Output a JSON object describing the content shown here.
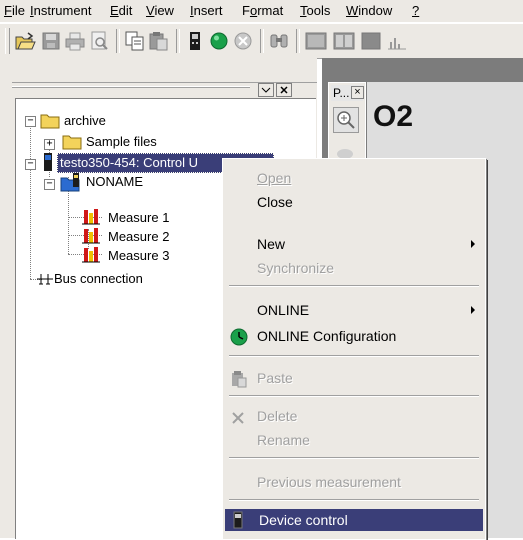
{
  "menubar": {
    "items": [
      {
        "u": "F",
        "rest": "ile"
      },
      {
        "u": "I",
        "rest": "nstrument"
      },
      {
        "u": "E",
        "rest": "dit"
      },
      {
        "u": "V",
        "rest": "iew"
      },
      {
        "u": "I",
        "rest": "nsert"
      },
      {
        "pre": "F",
        "u": "o",
        "rest": "rmat"
      },
      {
        "u": "T",
        "rest": "ools"
      },
      {
        "u": "W",
        "rest": "indow"
      },
      {
        "u": "?",
        "rest": ""
      }
    ]
  },
  "tree": {
    "archive": "archive",
    "sample_files": "Sample files",
    "device": "testo350-454: Control U",
    "noname": "NONAME",
    "measures": [
      "Measure 1",
      "Measure 2",
      "Measure 3"
    ],
    "bus": "Bus connection"
  },
  "ppanel": {
    "title": "P...",
    "close": "×"
  },
  "canvas": {
    "o2_label": "O2"
  },
  "context_menu": {
    "open": "Open",
    "close": "Close",
    "new": "New",
    "synchronize": "Synchronize",
    "online": "ONLINE",
    "online_config": "ONLINE Configuration",
    "paste": "Paste",
    "delete": "Delete",
    "rename": "Rename",
    "previous": "Previous measurement",
    "device_control": "Device control"
  },
  "colors": {
    "highlight": "#3a3e78",
    "folder": "#f3d35b",
    "bars": [
      "#d01818",
      "#f0c000"
    ]
  }
}
